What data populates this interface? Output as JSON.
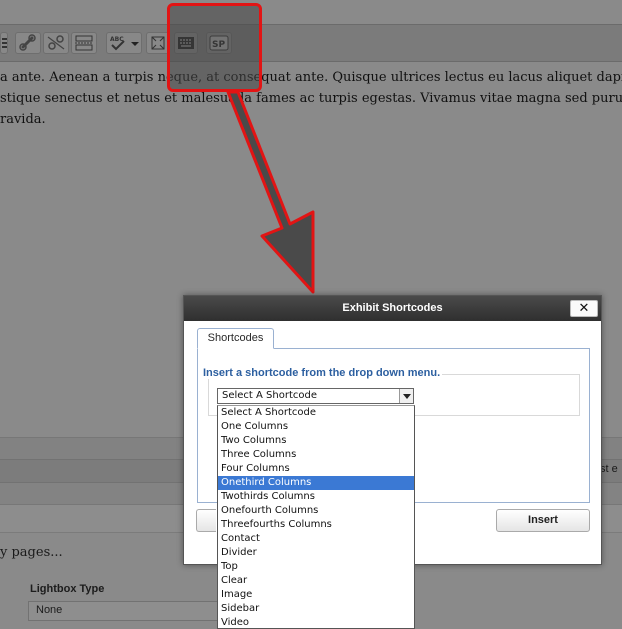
{
  "toolbar": {
    "buttons": [
      {
        "icon": "list-icon"
      },
      {
        "icon": "link-icon"
      },
      {
        "icon": "unlink-icon"
      },
      {
        "icon": "insert-more-icon"
      },
      {
        "icon": "spellcheck-icon",
        "label": "ABC"
      },
      {
        "icon": "fullscreen-icon"
      },
      {
        "icon": "keyboard-icon"
      },
      {
        "icon": "shortcode-icon",
        "label": "SP"
      }
    ]
  },
  "editor": {
    "lines": [
      "a ante. Aenean a turpis neque, at consequat ante. Quisque ultrices lectus eu lacus aliquet dapibus. Nullam quam",
      "stique senectus et netus et malesuada fames ac turpis egestas. Vivamus vitae magna sed purus vehicula sempe",
      "ravida."
    ]
  },
  "background": {
    "pages_text": "y pages...",
    "lightbox_label": "Lightbox Type",
    "lightbox_value": "None",
    "right_fragment": "st e"
  },
  "dialog": {
    "title": "Exhibit Shortcodes",
    "close_label": "✕",
    "tab_label": "Shortcodes",
    "legend": "Insert a shortcode from the drop down menu.",
    "select_value": "Select A Shortcode",
    "insert_label": "Insert",
    "options": [
      "Select A Shortcode",
      "One Columns",
      "Two Columns",
      "Three Columns",
      "Four Columns",
      "Onethird Columns",
      "Twothirds Columns",
      "Onefourth Columns",
      "Threefourths Columns",
      "Contact",
      "Divider",
      "Top",
      "Clear",
      "Image",
      "Sidebar",
      "Video"
    ],
    "highlighted_option": "Onethird Columns"
  },
  "colors": {
    "annotation_red": "#e21414",
    "selection_blue": "#3b79d4",
    "legend_blue": "#2c5fa0",
    "overlay_gray": "#8a8a8a"
  }
}
